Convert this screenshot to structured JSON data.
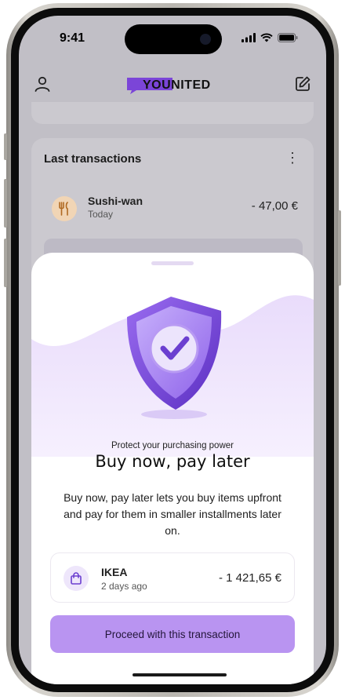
{
  "status_bar": {
    "time": "9:41"
  },
  "app_bar": {
    "brand": "YOUNITED"
  },
  "transactions_card": {
    "title": "Last transactions",
    "items": [
      {
        "merchant": "Sushi-wan",
        "date": "Today",
        "amount": "- 47,00 €",
        "icon": "fork-knife-icon"
      }
    ]
  },
  "sheet": {
    "kicker": "Protect your purchasing power",
    "headline": "Buy now, pay later",
    "body": "Buy now, pay later lets you buy items upfront and pay for them in smaller installments later on.",
    "transaction": {
      "merchant": "IKEA",
      "date": "2 days ago",
      "amount": "- 1 421,65 €",
      "icon": "shopping-bag-icon"
    },
    "cta_label": "Proceed with this transaction"
  },
  "colors": {
    "accent": "#b994f1",
    "brand": "#8b5cf6",
    "dim_background": "#c1bfc6"
  }
}
